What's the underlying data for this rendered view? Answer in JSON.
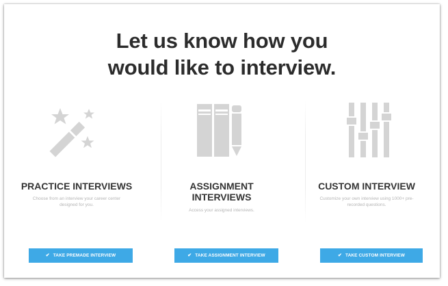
{
  "headline": {
    "line1": "Let us know how you",
    "line2": "would like to interview."
  },
  "colors": {
    "accent": "#3ea9e6",
    "icon_gray": "#d2d2d2",
    "title_text": "#333333"
  },
  "options": [
    {
      "icon": "magic-wand-stars-icon",
      "title_line1": "PRACTICE INTERVIEWS",
      "title_line2": "",
      "description": "Choose from an interview your career center designed for you.",
      "button_label": "TAKE PREMADE INTERVIEW",
      "button_icon": "check-icon"
    },
    {
      "icon": "books-pencil-icon",
      "title_line1": "ASSIGNMENT",
      "title_line2": "INTERVIEWS",
      "description": "Access your assigned interviews.",
      "button_label": "TAKE ASSIGNMENT INTERVIEW",
      "button_icon": "check-icon"
    },
    {
      "icon": "equalizer-sliders-icon",
      "title_line1": "CUSTOM INTERVIEW",
      "title_line2": "",
      "description": "Customize your own interview using 1000+ pre-recorded questions.",
      "button_label": "TAKE CUSTOM INTERVIEW",
      "button_icon": "check-icon"
    }
  ]
}
